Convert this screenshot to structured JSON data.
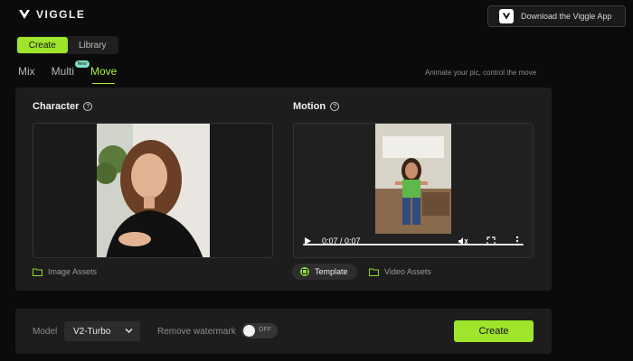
{
  "header": {
    "logo_text": "VIGGLE",
    "download_label": "Download the Viggle App"
  },
  "nav": {
    "tabs": [
      "Create",
      "Library"
    ],
    "active_tab": "Create"
  },
  "modes": {
    "items": [
      "Mix",
      "Multi",
      "Move"
    ],
    "active": "Move",
    "multi_badge": "New",
    "tagline": "Animate your pic, control the move"
  },
  "character": {
    "title": "Character",
    "assets_label": "Image Assets"
  },
  "motion": {
    "title": "Motion",
    "time": "0:07 / 0:07",
    "progress": 1.0,
    "template_label": "Template",
    "assets_label": "Video Assets"
  },
  "bottom": {
    "model_label": "Model",
    "model_value": "V2-Turbo",
    "watermark_label": "Remove watermark",
    "watermark_state": "OFF",
    "create_label": "Create"
  },
  "colors": {
    "accent": "#9ee52c",
    "panel": "#1d1d1d",
    "background": "#0b0b0b"
  }
}
